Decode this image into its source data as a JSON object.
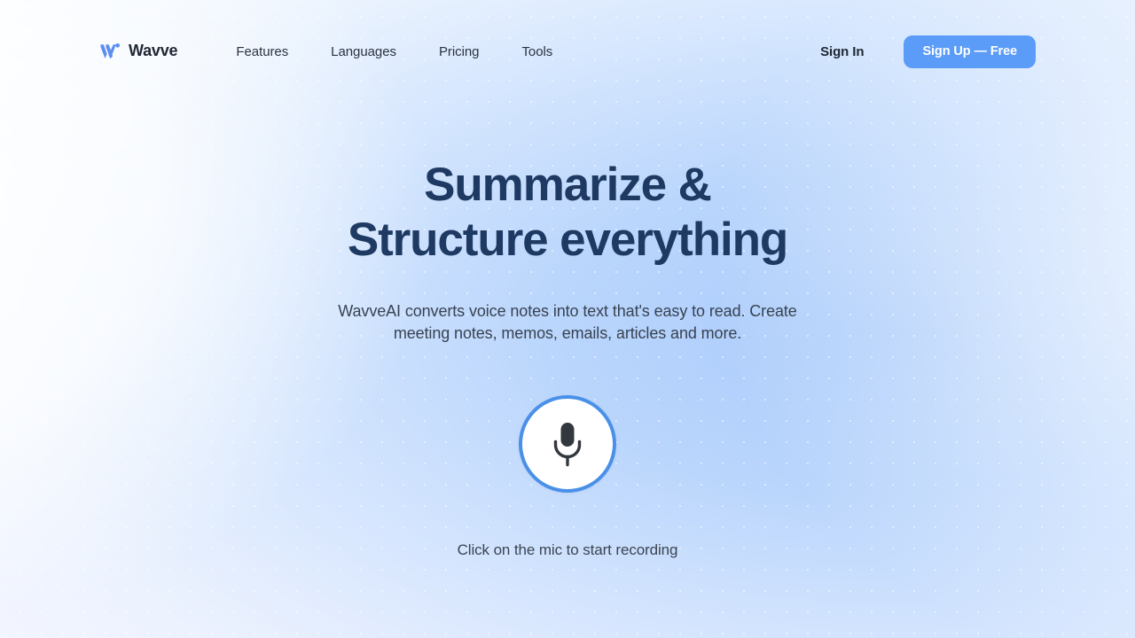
{
  "brand": {
    "name": "Wavve",
    "logo_icon": "wavve-w-mark-icon",
    "logo_color": "#5b8ef0"
  },
  "nav": {
    "items": [
      {
        "label": "Features"
      },
      {
        "label": "Languages"
      },
      {
        "label": "Pricing"
      },
      {
        "label": "Tools"
      }
    ]
  },
  "header_actions": {
    "sign_in_label": "Sign In",
    "sign_up_label": "Sign Up — Free",
    "sign_up_color": "#5b9cf8"
  },
  "hero": {
    "headline_line1": "Summarize &",
    "headline_line2": "Structure everything",
    "headline_color": "#1e3a63",
    "subtitle": "WavveAI converts voice notes into text that's easy to read. Create meeting notes, memos, emails, articles and more.",
    "mic_icon": "microphone-icon",
    "mic_ring_color": "#4a90e8",
    "mic_caption": "Click on the mic to start recording"
  }
}
